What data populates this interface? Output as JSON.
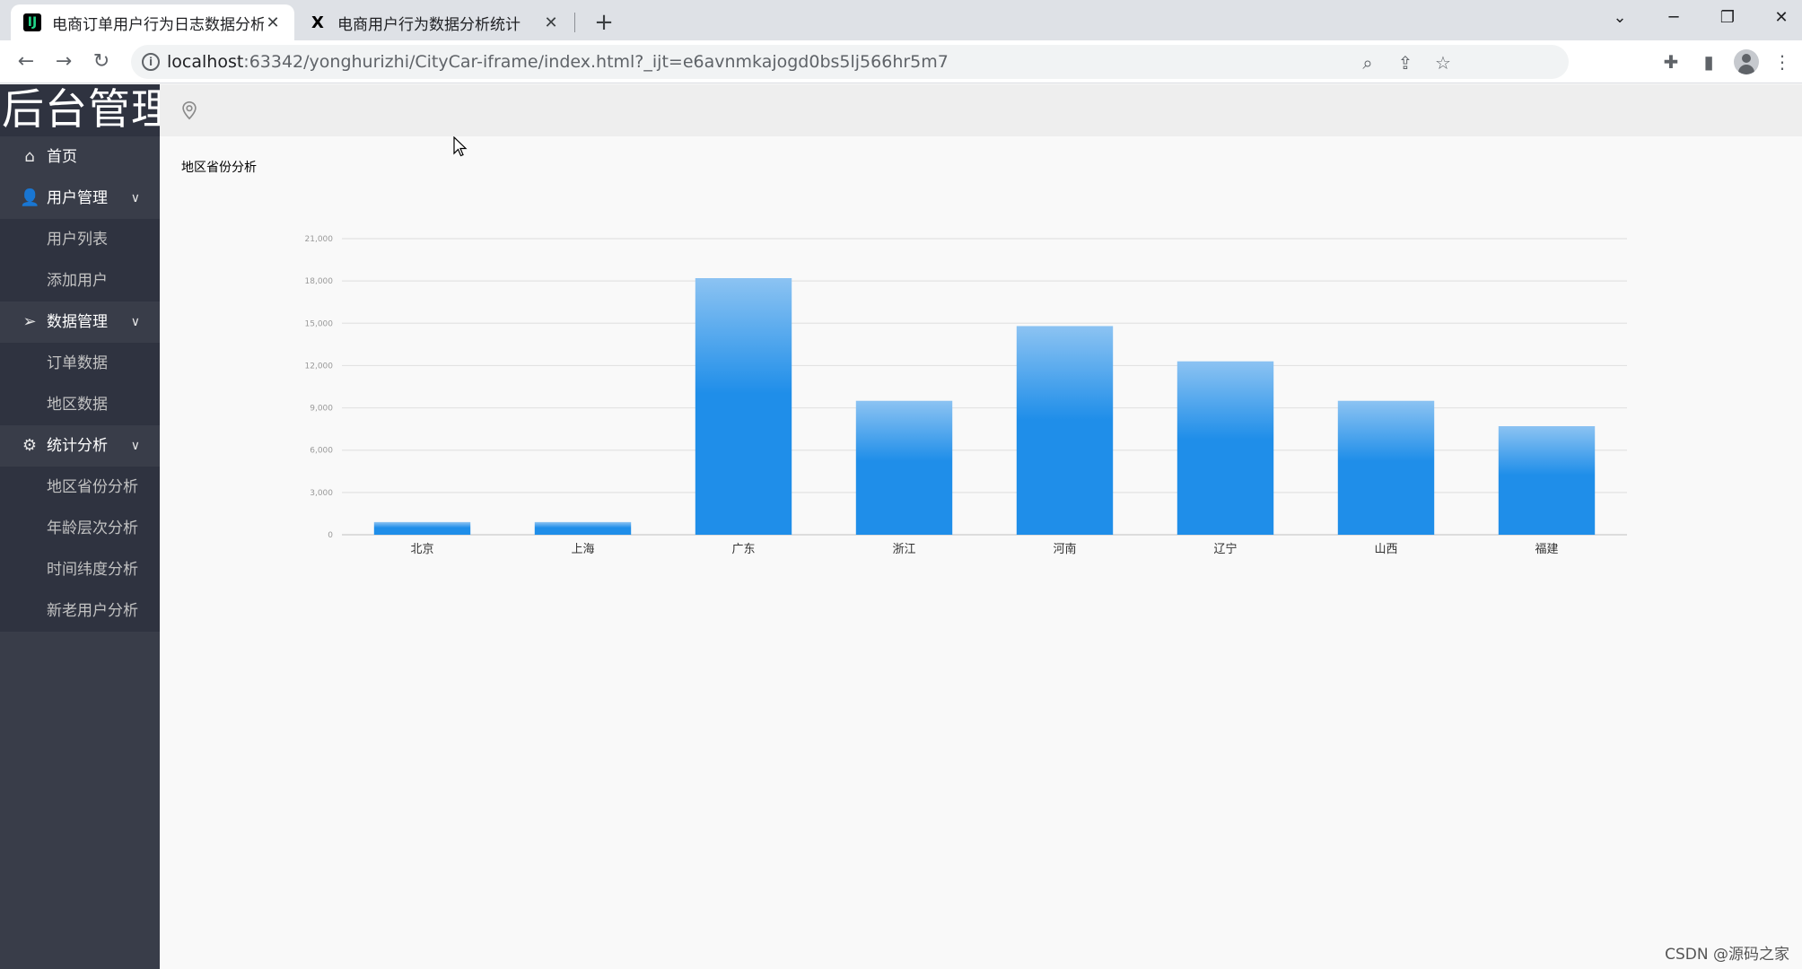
{
  "browser": {
    "tabs": [
      {
        "title": "电商订单用户行为日志数据分析系统",
        "active": true
      },
      {
        "title": "电商用户行为数据分析统计",
        "active": false
      }
    ],
    "url_host": "localhost",
    "url_rest": ":63342/yonghurizhi/CityCar-iframe/index.html?_ijt=e6avnmkajogd0bs5lj566hr5m7"
  },
  "sidebar": {
    "logo": "后台管理",
    "menu": [
      {
        "label": "首页",
        "icon": "home-icon",
        "children": []
      },
      {
        "label": "用户管理",
        "icon": "user-icon",
        "children": [
          "用户列表",
          "添加用户"
        ]
      },
      {
        "label": "数据管理",
        "icon": "send-icon",
        "children": [
          "订单数据",
          "地区数据"
        ]
      },
      {
        "label": "统计分析",
        "icon": "gear-icon",
        "children": [
          "地区省份分析",
          "年龄层次分析",
          "时间纬度分析",
          "新老用户分析"
        ]
      }
    ]
  },
  "main": {
    "section_title": "地区省份分析"
  },
  "watermark": "CSDN @源码之家",
  "colors": {
    "bar_top": "#8cc3f2",
    "bar_bottom": "#1f8ee9",
    "sidebar_bg": "#393d49"
  },
  "chart_data": {
    "type": "bar",
    "categories": [
      "北京",
      "上海",
      "广东",
      "浙江",
      "河南",
      "辽宁",
      "山西",
      "福建"
    ],
    "values": [
      900,
      900,
      18200,
      9500,
      14800,
      12300,
      9500,
      7700
    ],
    "ylim": [
      0,
      21000
    ],
    "yticks": [
      "0",
      "3,000",
      "6,000",
      "9,000",
      "12,000",
      "15,000",
      "18,000",
      "21,000"
    ],
    "ytick_values": [
      0,
      3000,
      6000,
      9000,
      12000,
      15000,
      18000,
      21000
    ],
    "grid": true,
    "legend": "none"
  }
}
